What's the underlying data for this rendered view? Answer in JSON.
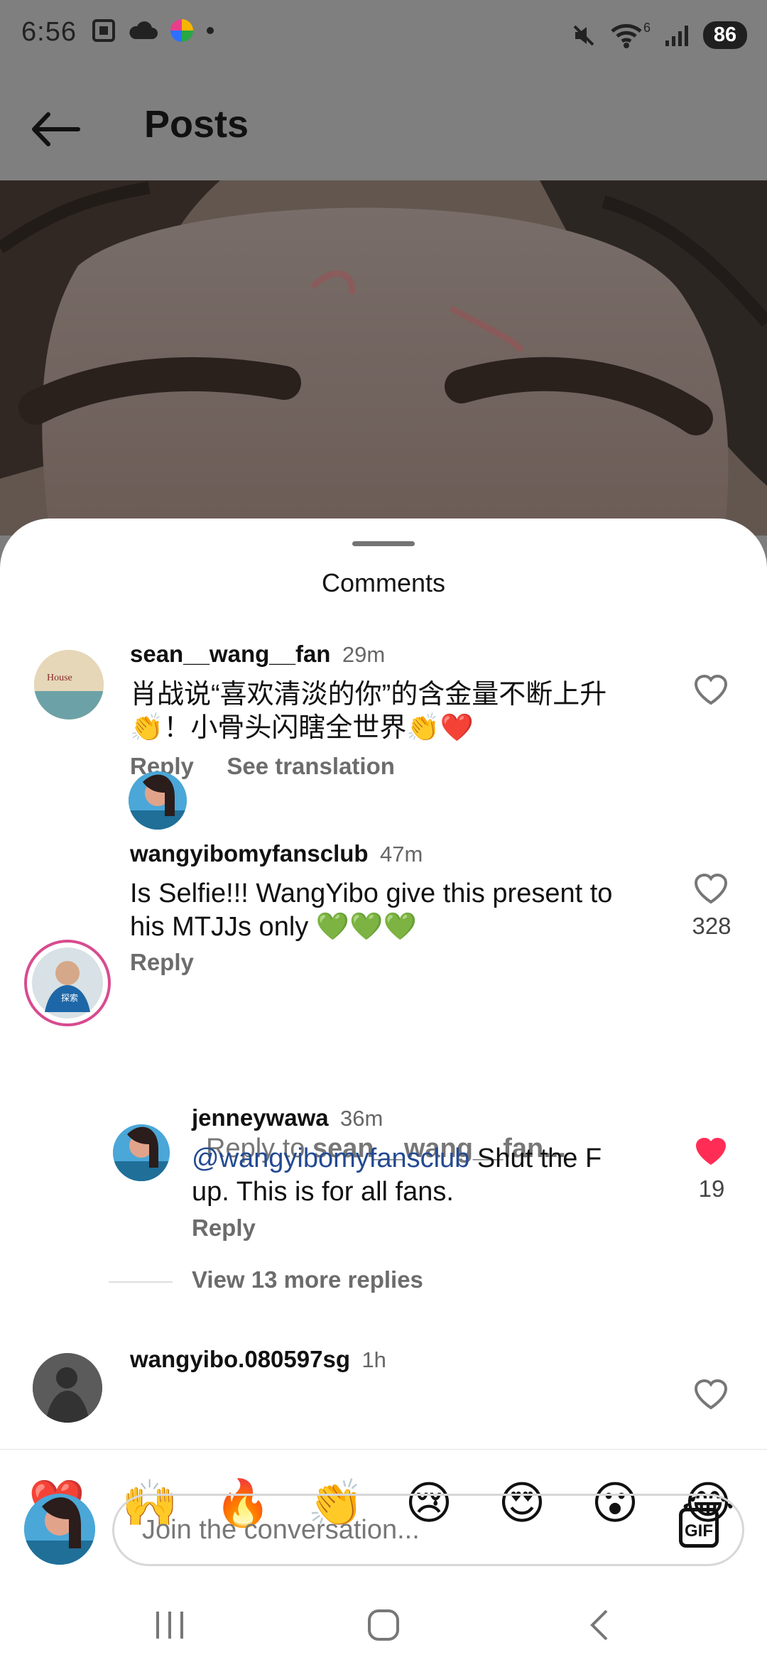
{
  "status": {
    "time": "6:56",
    "wifi_signal_label": "6",
    "battery": "86",
    "icons": [
      "screenshot-icon",
      "cloud-icon",
      "colorful-app-icon",
      "dot-icon",
      "mute-icon",
      "wifi-icon",
      "signal-icon"
    ]
  },
  "appbar": {
    "title": "Posts"
  },
  "comments_sheet": {
    "title": "Comments"
  },
  "comments": [
    {
      "username": "sean__wang__fan",
      "time": "29m",
      "text_line1": "肖战说“喜欢清淡的你”的含金量不断上升",
      "text_line2": "👏！小骨头闪瞎全世界👏❤️",
      "reply": "Reply",
      "translation": "See translation"
    },
    {
      "username": "wangyibomyfansclub",
      "time": "47m",
      "text_line1": "Is Selfie!!! WangYibo give this present to",
      "text_line2": "his MTJJs only 💚💚💚",
      "reply": "Reply",
      "likes": "328"
    },
    {
      "username": "jenneywawa",
      "time": "36m",
      "mention": "@wangyibomyfansclub",
      "text_line1_rest": " Shut the F",
      "text_line2": "up. This is for all fans.",
      "reply": "Reply",
      "likes": "19"
    },
    {
      "username": "wangyibo.080597sg",
      "time": "1h"
    }
  ],
  "reply_prompt": {
    "prefix": "Reply to ",
    "target": "sean__wang__fan..."
  },
  "view_more": "View 13 more replies",
  "emoji_reactions": [
    "❤️",
    "🙌",
    "🔥",
    "👏",
    "😢",
    "😍",
    "😮",
    "😂"
  ],
  "composer": {
    "placeholder": "Join the conversation...",
    "gif": "GIF"
  },
  "colors": {
    "liked_heart": "#ff2d55",
    "mention": "#234a92",
    "sheet_bg": "#ffffff",
    "overlay": "#7f7f7f"
  }
}
